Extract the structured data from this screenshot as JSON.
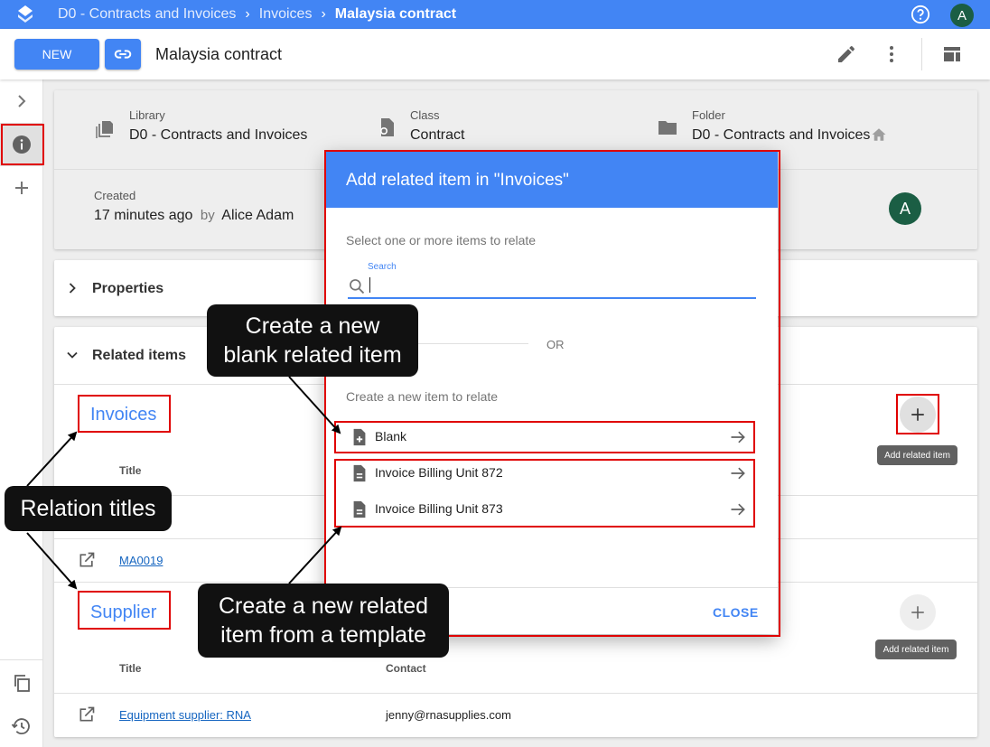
{
  "breadcrumb": {
    "items": [
      "D0 - Contracts and Invoices",
      "Invoices"
    ],
    "current": "Malaysia contract"
  },
  "user": {
    "initial": "A"
  },
  "toolbar": {
    "new_label": "NEW",
    "title": "Malaysia contract"
  },
  "metadata": {
    "library_label": "Library",
    "library_value": "D0 - Contracts and Invoices",
    "class_label": "Class",
    "class_value": "Contract",
    "folder_label": "Folder",
    "folder_value": "D0 - Contracts and Invoices",
    "created_label": "Created",
    "created_time": "17 minutes ago",
    "created_by_word": "by",
    "created_by": "Alice Adam"
  },
  "properties": {
    "label": "Properties"
  },
  "related": {
    "label": "Related items",
    "invoices": {
      "title": "Invoices",
      "col_title": "Title",
      "row_link": "MA0019",
      "add_tooltip": "Add related item"
    },
    "supplier": {
      "title": "Supplier",
      "col_title": "Title",
      "col_contact": "Contact",
      "row_link": "Equipment supplier: RNA",
      "row_contact": "jenny@rnasupplies.com",
      "add_tooltip": "Add related item"
    }
  },
  "dialog": {
    "title": "Add related item in \"Invoices\"",
    "select_text": "Select one or more items to relate",
    "search_label": "Search",
    "or_text": "OR",
    "create_text": "Create a new item to relate",
    "items": [
      "Blank",
      "Invoice Billing Unit 872",
      "Invoice Billing Unit 873"
    ],
    "close_label": "CLOSE"
  },
  "callouts": {
    "blank": [
      "Create a new",
      "blank related item"
    ],
    "relation": "Relation titles",
    "template": [
      "Create a new related",
      "item from a template"
    ]
  },
  "colors": {
    "primary": "#4285f4",
    "highlight": "#e00000",
    "avatar": "#1b5e44"
  }
}
